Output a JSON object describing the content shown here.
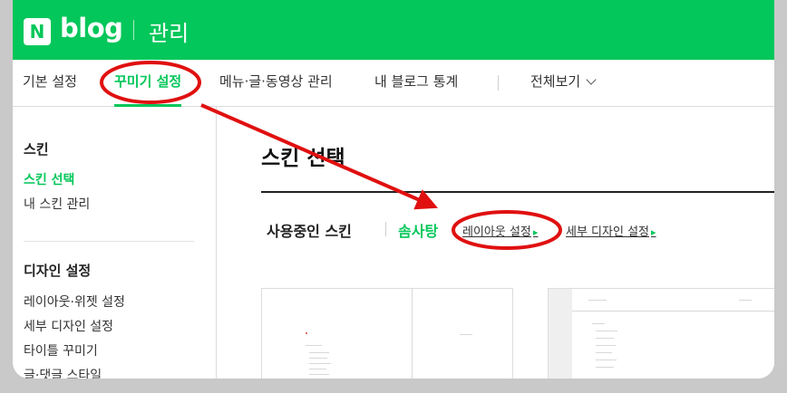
{
  "header": {
    "logo_mark": "N",
    "logo_text": "blog",
    "section": "관리"
  },
  "tabs": [
    {
      "label": "기본 설정",
      "active": false
    },
    {
      "label": "꾸미기 설정",
      "active": true
    },
    {
      "label": "메뉴·글·동영상 관리",
      "active": false
    },
    {
      "label": "내 블로그 통계",
      "active": false
    }
  ],
  "view_all": "전체보기",
  "sidebar": {
    "skin_title": "스킨",
    "skin_items": [
      {
        "label": "스킨 선택",
        "active": true
      },
      {
        "label": "내 스킨 관리",
        "active": false
      }
    ],
    "design_title": "디자인 설정",
    "design_items": [
      {
        "label": "레이아웃·위젯 설정"
      },
      {
        "label": "세부 디자인 설정"
      },
      {
        "label": "타이틀 꾸미기"
      },
      {
        "label": "글·댓글 스타일"
      }
    ]
  },
  "main": {
    "title": "스킨 선택",
    "current_skin_label": "사용중인 스킨",
    "current_skin_name": "솜사탕",
    "layout_link": "레이아웃 설정",
    "detail_link": "세부 디자인 설정"
  },
  "colors": {
    "brand": "#03c75a",
    "annotation": "#e01010"
  },
  "icons": {
    "view_all": "chevron-down-icon",
    "link_arrow": "triangle-right-icon"
  }
}
